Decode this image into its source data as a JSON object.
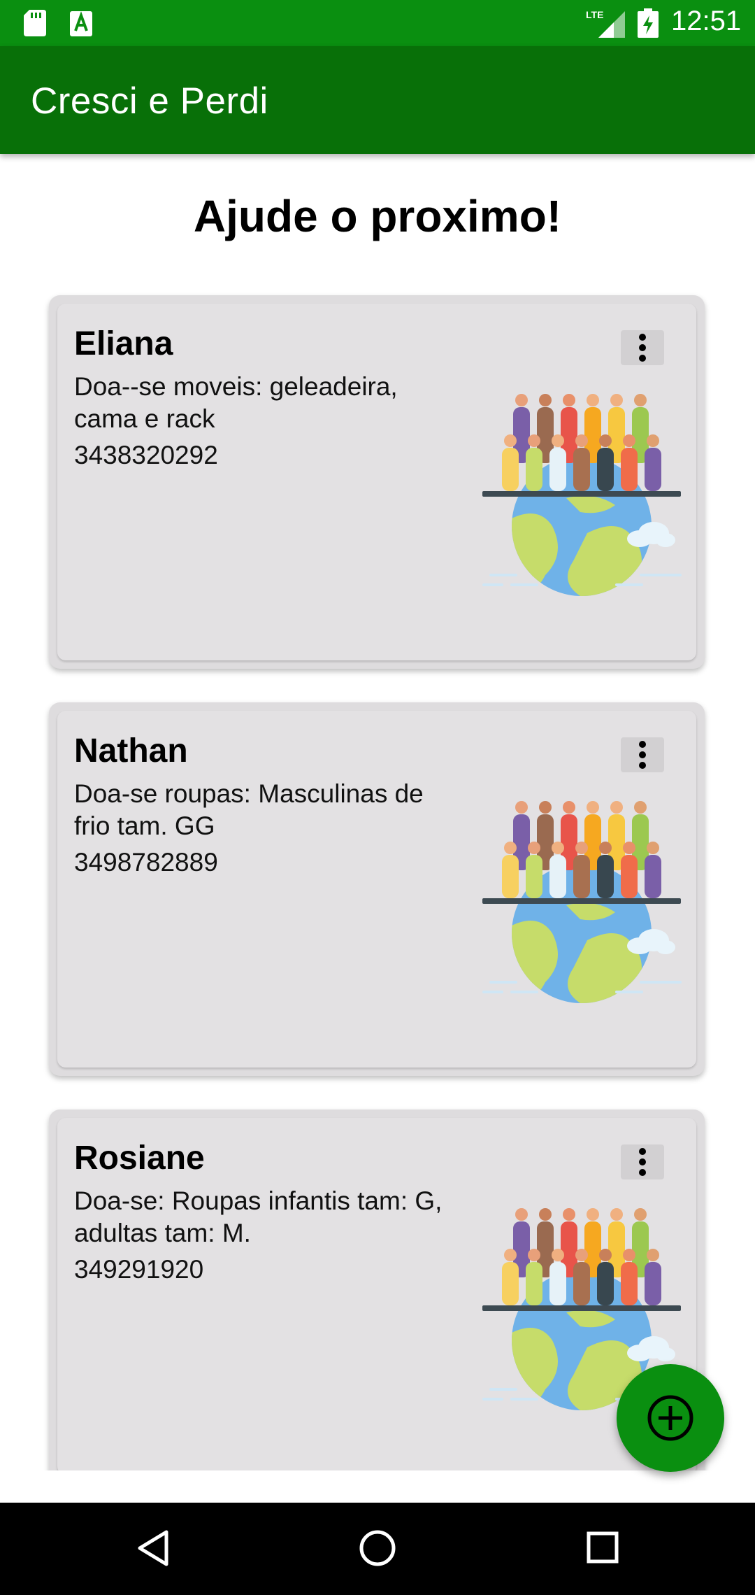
{
  "status_bar": {
    "network": "LTE",
    "time": "12:51",
    "left_icons": [
      "sd-card-icon",
      "a-notification-icon"
    ],
    "right_icons": [
      "lte-signal-icon",
      "battery-charging-icon"
    ]
  },
  "app_bar": {
    "title": "Cresci e Perdi",
    "color": "#087008"
  },
  "page": {
    "heading": "Ajude o proximo!"
  },
  "posts": [
    {
      "name": "Eliana",
      "description": "Doa--se moveis: geleadeira, cama e rack",
      "phone": "3438320292",
      "menu_icon": "more-vert-icon",
      "image": "people-on-globe-illustration"
    },
    {
      "name": "Nathan",
      "description": "Doa-se roupas: Masculinas de frio tam. GG",
      "phone": "3498782889",
      "menu_icon": "more-vert-icon",
      "image": "people-on-globe-illustration"
    },
    {
      "name": "Rosiane",
      "description": "Doa-se: Roupas infantis tam: G, adultas tam: M.",
      "phone": "349291920",
      "menu_icon": "more-vert-icon",
      "image": "people-on-globe-illustration"
    }
  ],
  "fab": {
    "icon": "add-circle-icon",
    "color": "#0a8f10"
  },
  "nav_bar": {
    "icons": [
      "back-icon",
      "home-icon",
      "recents-icon"
    ]
  }
}
